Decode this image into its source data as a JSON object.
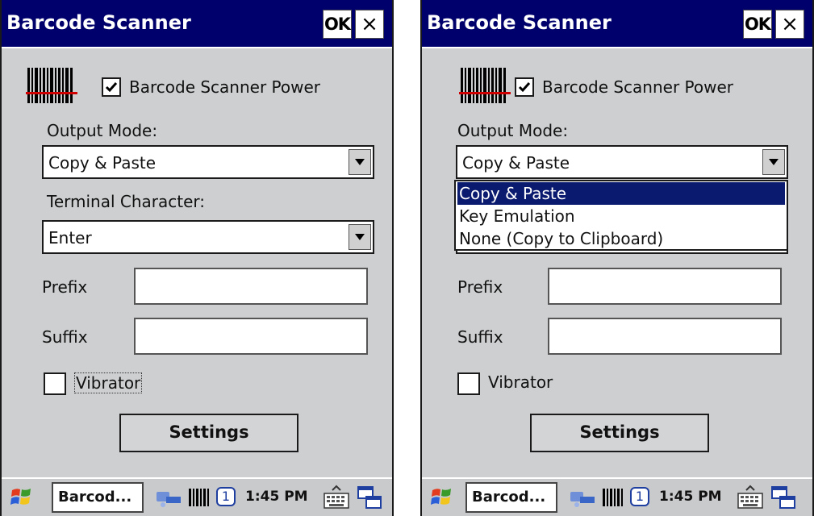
{
  "screens": [
    {
      "title": "Barcode Scanner",
      "ok_label": "OK",
      "close_label": "×",
      "power_label": "Barcode Scanner Power",
      "power_checked": true,
      "output_mode_label": "Output Mode:",
      "output_mode_value": "Copy & Paste",
      "terminal_label": "Terminal Character:",
      "terminal_value": "Enter",
      "prefix_label": "Prefix",
      "prefix_value": "",
      "suffix_label": "Suffix",
      "suffix_value": "",
      "vibrator_label": "Vibrator",
      "vibrator_checked": false,
      "settings_label": "Settings",
      "taskbar": {
        "task_label": "Barcod...",
        "clock": "1:45 PM",
        "badge": "1"
      }
    },
    {
      "title": "Barcode Scanner",
      "ok_label": "OK",
      "close_label": "×",
      "power_label": "Barcode Scanner Power",
      "power_checked": true,
      "output_mode_label": "Output Mode:",
      "output_mode_value": "Copy & Paste",
      "dropdown_options": [
        "Copy & Paste",
        "Key Emulation",
        "None (Copy to Clipboard)"
      ],
      "dropdown_selected": "Copy & Paste",
      "prefix_label": "Prefix",
      "prefix_value": "",
      "suffix_label": "Suffix",
      "suffix_value": "",
      "vibrator_label": "Vibrator",
      "vibrator_checked": false,
      "settings_label": "Settings",
      "taskbar": {
        "task_label": "Barcod...",
        "clock": "1:45 PM",
        "badge": "1"
      }
    }
  ],
  "colors": {
    "titlebar": "#00006d",
    "window_bg": "#cdcfd0",
    "selection": "#0a1a6e"
  }
}
